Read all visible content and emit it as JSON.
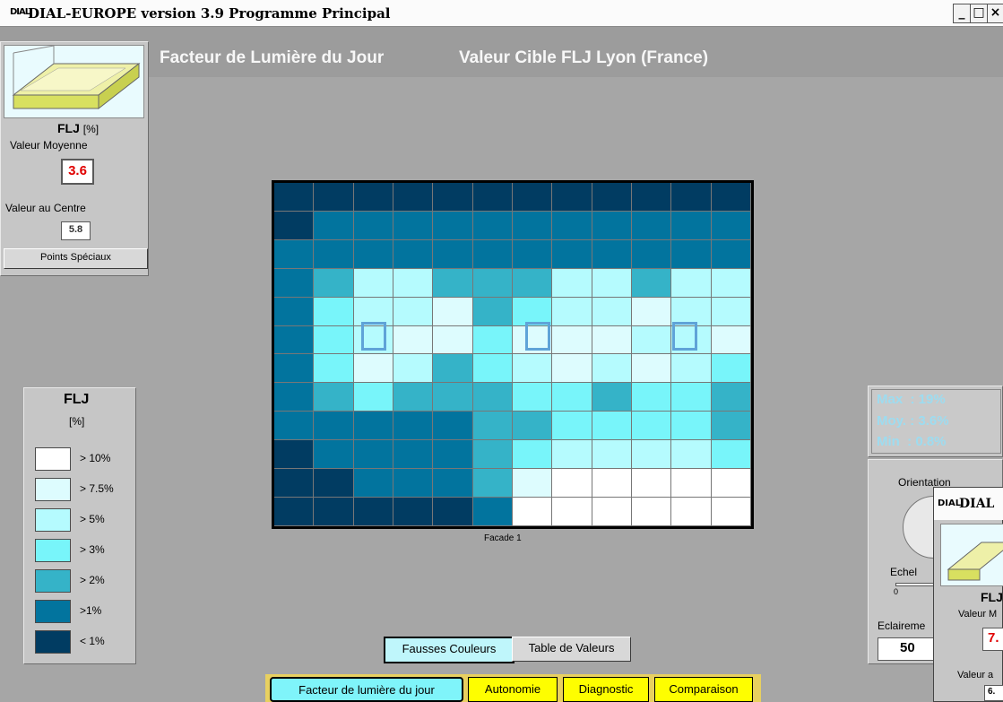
{
  "window": {
    "logo": "DIAL",
    "title": "DIAL-EUROPE version 3.9 Programme Principal",
    "min": "_",
    "max": "□",
    "close": "×"
  },
  "header": {
    "left": "Facteur de Lumière du Jour",
    "right": "Valeur Cible FLJ Lyon (France)"
  },
  "summary": {
    "metric": "FLJ",
    "unit": "[%]",
    "mean_label": "Valeur Moyenne",
    "mean_value": "3.6",
    "center_label": "Valeur au Centre",
    "center_value": "5.8",
    "special_points_button": "Points Spéciaux"
  },
  "legend": {
    "title": "FLJ",
    "unit": "[%]",
    "items": [
      {
        "label": "> 10%",
        "color": "#ffffff"
      },
      {
        "label": "> 7.5%",
        "color": "#ddfcfe"
      },
      {
        "label": "> 5%",
        "color": "#b5fbfe"
      },
      {
        "label": "> 3%",
        "color": "#78f5fa"
      },
      {
        "label": "> 2%",
        "color": "#35b3c8"
      },
      {
        "label": ">1%",
        "color": "#02749e"
      },
      {
        "label": "< 1%",
        "color": "#013c62"
      }
    ]
  },
  "grid": {
    "caption": "Facade 1",
    "levels": [
      [
        6,
        6,
        6,
        6,
        6,
        6,
        6,
        6,
        6,
        6,
        6,
        6
      ],
      [
        6,
        5,
        5,
        5,
        5,
        5,
        5,
        5,
        5,
        5,
        5,
        5
      ],
      [
        5,
        5,
        5,
        5,
        5,
        5,
        5,
        5,
        5,
        5,
        5,
        5
      ],
      [
        5,
        4,
        2,
        2,
        4,
        4,
        4,
        2,
        2,
        4,
        2,
        2,
        4
      ],
      [
        5,
        3,
        2,
        2,
        1,
        4,
        3,
        2,
        2,
        1,
        2,
        2,
        3
      ],
      [
        5,
        3,
        2,
        1,
        1,
        3,
        1,
        1,
        1,
        2,
        2,
        1,
        3
      ],
      [
        5,
        3,
        1,
        2,
        4,
        3,
        2,
        1,
        2,
        1,
        2,
        3
      ],
      [
        5,
        4,
        3,
        4,
        4,
        4,
        3,
        3,
        4,
        3,
        3,
        4
      ],
      [
        5,
        5,
        5,
        5,
        5,
        4,
        4,
        3,
        3,
        3,
        3,
        4
      ],
      [
        6,
        5,
        5,
        5,
        5,
        4,
        3,
        2,
        2,
        2,
        2,
        3
      ],
      [
        6,
        6,
        5,
        5,
        5,
        4,
        1,
        0,
        0,
        0,
        0,
        0
      ],
      [
        6,
        6,
        6,
        6,
        6,
        5,
        0,
        0,
        0,
        0,
        0,
        0
      ]
    ]
  },
  "view_buttons": {
    "false_colors": "Fausses Couleurs",
    "table": "Table de Valeurs"
  },
  "nav": {
    "tabs": [
      "Facteur de lumière du jour",
      "Autonomie",
      "Diagnostic",
      "Comparaison"
    ]
  },
  "stats": {
    "max": "Max  : 19%",
    "moy": "Moy. : 3.6%",
    "min": "Min  : 0.8%"
  },
  "right_panel": {
    "orientation_label": "Orientation",
    "scale_label": "Echel",
    "scale_zero": "0",
    "lighting_label": "Eclaireme",
    "lighting_value": "50"
  },
  "second_window": {
    "logo": "DIAL",
    "title": "DIAL",
    "metric": "FLJ",
    "mean_label": "Valeur M",
    "mean_value": "7.",
    "center_label": "Valeur a",
    "center_value": "6."
  }
}
